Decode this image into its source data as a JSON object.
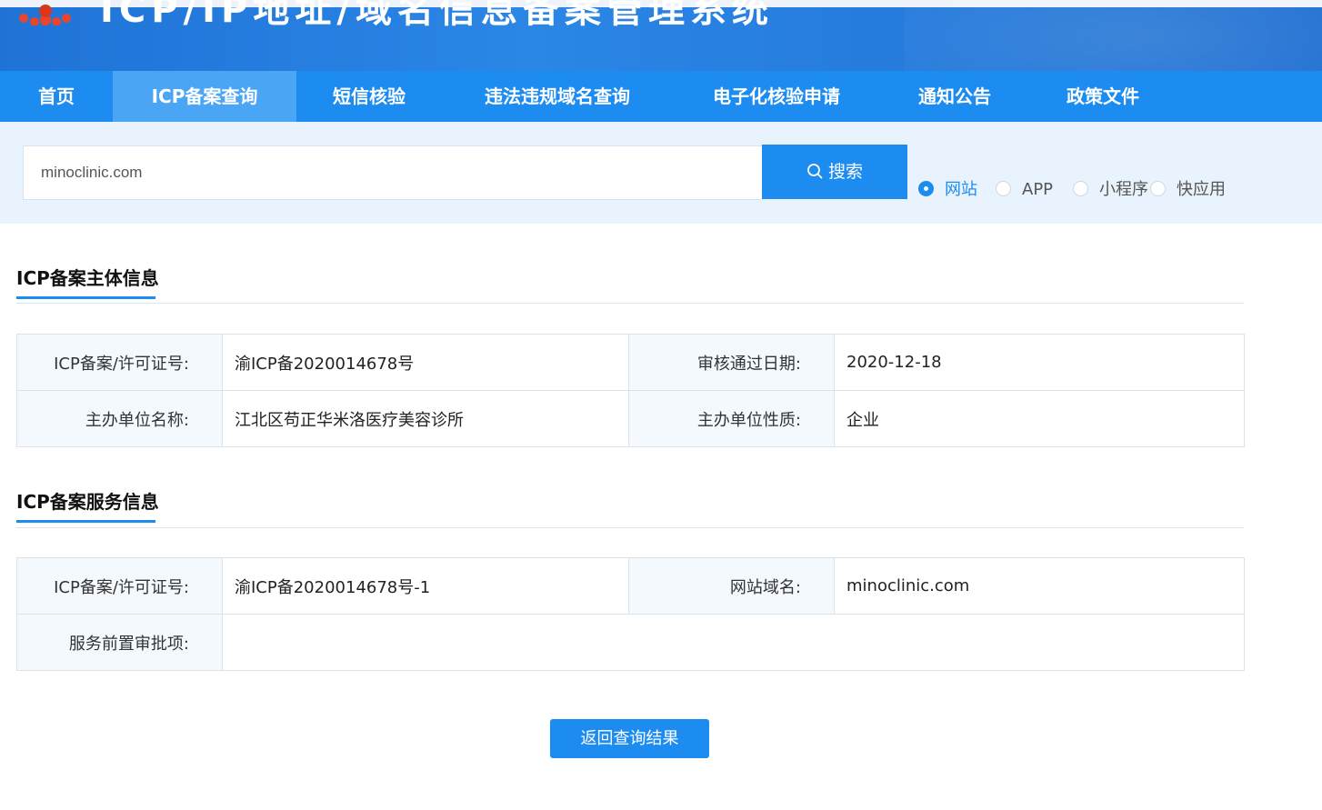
{
  "header": {
    "title": "ICP/IP地址/域名信息备案管理系统",
    "logo_icon": "national-emblem-icon",
    "brand_color": "#1d8cf0"
  },
  "nav": {
    "items": [
      {
        "label": "首页"
      },
      {
        "label": "ICP备案查询",
        "active": true
      },
      {
        "label": "短信核验"
      },
      {
        "label": "违法违规域名查询"
      },
      {
        "label": "电子化核验申请"
      },
      {
        "label": "通知公告"
      },
      {
        "label": "政策文件"
      }
    ]
  },
  "search": {
    "value": "minoclinic.com",
    "button_label": "搜索",
    "button_icon": "search-icon",
    "types": [
      {
        "label": "网站",
        "checked": true
      },
      {
        "label": "APP",
        "checked": false
      },
      {
        "label": "小程序",
        "checked": false
      },
      {
        "label": "快应用",
        "checked": false
      }
    ]
  },
  "subject_section": {
    "title": "ICP备案主体信息",
    "rows": [
      {
        "k1": "ICP备案/许可证号:",
        "v1": "渝ICP备2020014678号",
        "k2": "审核通过日期:",
        "v2": "2020-12-18"
      },
      {
        "k1": "主办单位名称:",
        "v1": "江北区苟正华米洛医疗美容诊所",
        "k2": "主办单位性质:",
        "v2": "企业"
      }
    ]
  },
  "service_section": {
    "title": "ICP备案服务信息",
    "license_key": "ICP备案/许可证号:",
    "license_value": "渝ICP备2020014678号-1",
    "domain_key": "网站域名:",
    "domain_value": "minoclinic.com",
    "preapproval_key": "服务前置审批项:",
    "preapproval_value": ""
  },
  "back_button_label": "返回查询结果"
}
